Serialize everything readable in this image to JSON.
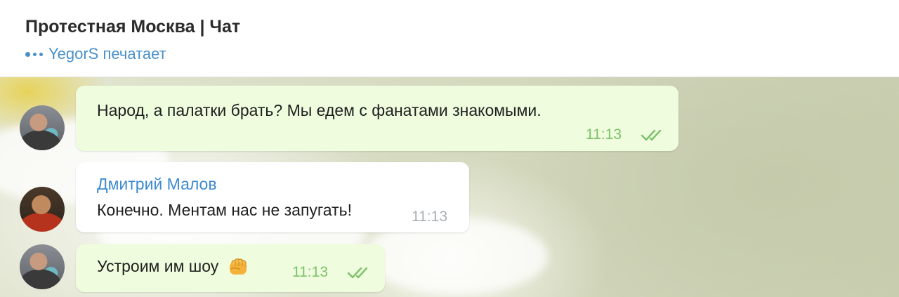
{
  "header": {
    "title": "Протестная Москва | Чат",
    "typing_status": "YegorS печатает"
  },
  "messages": [
    {
      "direction": "outgoing",
      "text": "Народ, а палатки брать? Мы едем с фанатами знакомыми.",
      "time": "11:13",
      "status_icon": "double-check-icon"
    },
    {
      "direction": "incoming",
      "sender": "Дмитрий Малов",
      "text": "Конечно. Ментам нас не запугать!",
      "time": "11:13"
    },
    {
      "direction": "outgoing",
      "text": "Устроим им шоу",
      "emoji": "fist-emoji-icon",
      "time": "11:13",
      "status_icon": "double-check-icon"
    }
  ],
  "colors": {
    "accent": "#3d8bcf",
    "outgoing_bubble": "#effdde",
    "read_check": "#7cc169"
  }
}
